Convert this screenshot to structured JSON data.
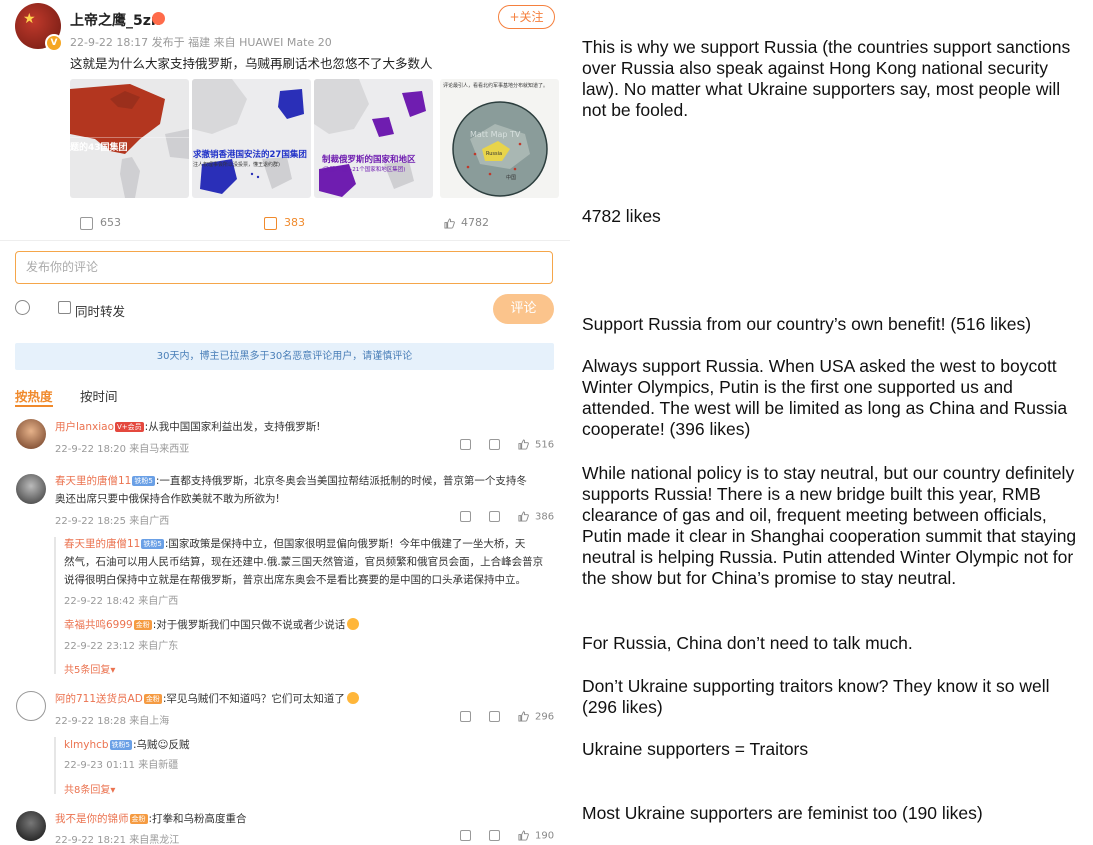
{
  "post": {
    "username": "上帝之鹰_5zn",
    "follow_label": "+关注",
    "meta": "22-9-22 18:17  发布于 福建   来自 HUAWEI Mate 20",
    "text": "这就是为什么大家支持俄罗斯，乌贼再刷话术也忽悠不了大多数人",
    "images": [
      {
        "caption": "题的43国集团"
      },
      {
        "caption": "求撤销香港国安法的27国集团",
        "subcaption": "注人权理事会所以没投票，懂王退约群)"
      },
      {
        "caption": "制裁俄罗斯的国家和地区",
        "subcaption": "(欧盟27国+21个国家和地区集团)"
      },
      {
        "caption": "评论最引人，看看北约军事基地分布就知道了。",
        "watermark": "Matt Map TV",
        "label1": "Russia",
        "label2": "中国"
      }
    ],
    "actions": {
      "share": "653",
      "comments": "383",
      "likes": "4782"
    }
  },
  "composer": {
    "placeholder": "发布你的评论",
    "repost_label": "同时转发",
    "submit_label": "评论"
  },
  "notice": "30天内，博主已拉黑多于30名恶意评论用户，请谨慎评论",
  "tabs": [
    "按热度",
    "按时间"
  ],
  "comments": [
    {
      "name": "用户lanxiao",
      "badges": [
        "V+会员"
      ],
      "text": ":从我中国国家利益出发，支持俄罗斯!",
      "meta": "22-9-22 18:20 来自马来西亚",
      "likes": "516"
    },
    {
      "name": "春天里的唐僧11",
      "badges": [
        "铁粉5"
      ],
      "text_lines": [
        ":一直都支持俄罗斯，北京冬奥会当美国拉帮结派抵制的时候，普京第一个支持冬",
        "奥还出席只要中俄保持合作欧美就不敢为所欲为!"
      ],
      "meta": "22-9-22 18:25 来自广西",
      "likes": "386",
      "replies": [
        {
          "name": "春天里的唐僧11",
          "badges": [
            "铁粉5"
          ],
          "text_lines": [
            ":国家政策是保持中立，但国家很明显偏向俄罗斯！今年中俄建了一坐大桥，天",
            "然气，石油可以用人民币结算，现在还建中.俄.蒙三国天然管道，官员频繁和俄官员会面，上合峰会普京",
            "说得很明白保持中立就是在帮俄罗斯，普京出席东奥会不是看比赛要的是中国的口头承诺保持中立。"
          ],
          "meta": "22-9-22 18:42 来自广西"
        },
        {
          "name": "幸福共鸣6999",
          "badges": [
            "金粉"
          ],
          "text": ":对于俄罗斯我们中国只做不说或者少说话",
          "meta": "22-9-22 23:12 来自广东"
        }
      ],
      "more_replies": "共5条回复"
    },
    {
      "name": "阿的711送货员AD",
      "badges": [
        "金粉"
      ],
      "text": ":罕见乌贼们不知道吗？它们可太知道了",
      "meta": "22-9-22 18:28 来自上海",
      "likes": "296",
      "replies": [
        {
          "name": "klmyhcb",
          "badges": [
            "铁粉5"
          ],
          "text": ":乌贼☺反贼",
          "meta": "22-9-23 01:11 来自新疆"
        }
      ],
      "more_replies": "共8条回复"
    },
    {
      "name": "我不是你的锦师",
      "badges": [
        "金粉"
      ],
      "text": ":打拳和乌粉高度重合",
      "meta": "22-9-22 18:21 来自黑龙江",
      "likes": "190"
    }
  ],
  "translations": [
    "This is why we support Russia (the countries support sanctions over Russia also speak against Hong Kong national security law). No matter what Ukraine supporters say, most people will not be fooled.",
    "4782 likes",
    "Support Russia from our country’s own benefit! (516 likes)",
    "Always support Russia. When USA asked the west to boycott Winter Olympics, Putin is the first one supported us and attended. The west will be limited as long as China and Russia cooperate! (396 likes)",
    "While national policy is to stay neutral, but our country definitely supports Russia! There is a new bridge built this year, RMB clearance of gas and oil, frequent meeting between officials, Putin made it clear in Shanghai cooperation summit that staying neutral is helping Russia. Putin attended Winter Olympic not for the show but for China’s promise to stay neutral.",
    "For Russia, China don’t need to talk much.",
    "Don’t Ukraine supporting traitors know? They know it so well (296 likes)",
    "Ukraine supporters = Traitors",
    "Most Ukraine supporters are feminist too (190 likes)"
  ],
  "colors": {
    "accent": "#f08a2c",
    "name": "#eb7350",
    "notice_bg": "#e6f1fb",
    "notice_text": "#4a7fb8"
  }
}
